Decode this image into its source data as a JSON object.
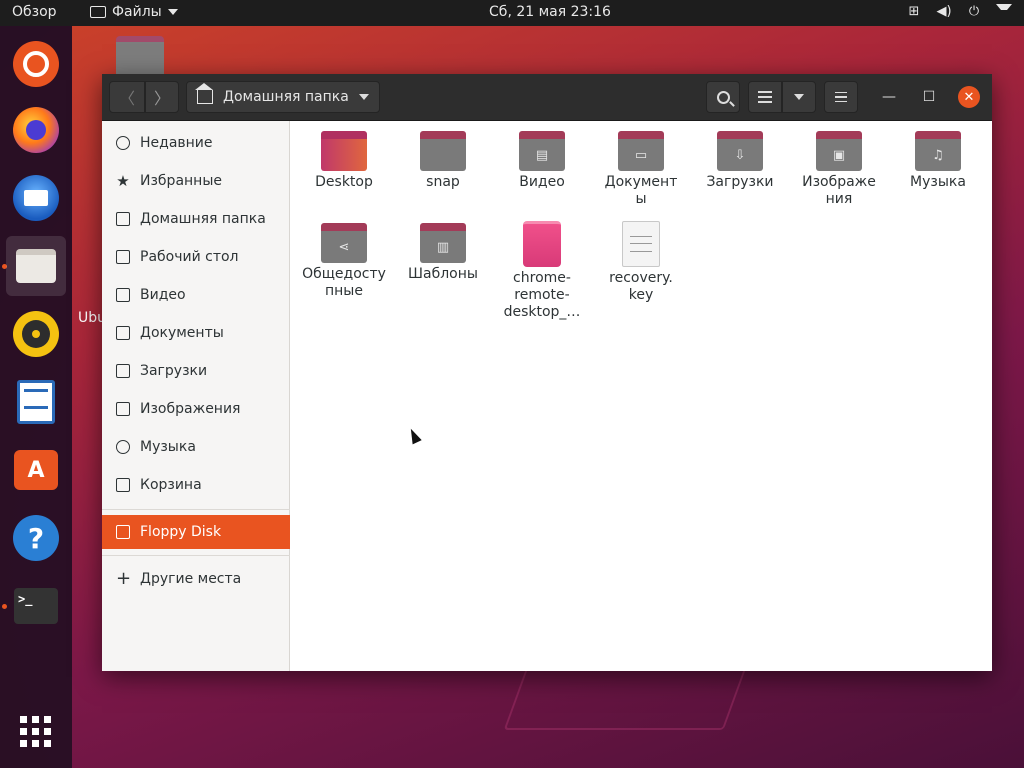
{
  "topbar": {
    "activities": "Обзор",
    "app_menu": "Файлы",
    "clock": "Сб, 21 мая  23:16"
  },
  "dock": {
    "items": [
      {
        "name": "ubuntu"
      },
      {
        "name": "firefox"
      },
      {
        "name": "thunderbird"
      },
      {
        "name": "files",
        "active": true
      },
      {
        "name": "rhythmbox"
      },
      {
        "name": "libreoffice-writer"
      },
      {
        "name": "ubuntu-software"
      },
      {
        "name": "help"
      },
      {
        "name": "terminal"
      }
    ],
    "terminal_glyph": ">_"
  },
  "desktop": {
    "partial_label": "Ubu"
  },
  "window": {
    "path": "Домашняя папка",
    "sidebar": [
      {
        "label": "Недавние",
        "icon": "clock-icon"
      },
      {
        "label": "Избранные",
        "icon": "star-icon"
      },
      {
        "label": "Домашняя папка",
        "icon": "home-icon"
      },
      {
        "label": "Рабочий стол",
        "icon": "desktop-icon"
      },
      {
        "label": "Видео",
        "icon": "video-icon"
      },
      {
        "label": "Документы",
        "icon": "document-icon"
      },
      {
        "label": "Загрузки",
        "icon": "download-icon"
      },
      {
        "label": "Изображения",
        "icon": "image-icon"
      },
      {
        "label": "Музыка",
        "icon": "music-icon"
      },
      {
        "label": "Корзина",
        "icon": "trash-icon"
      },
      {
        "label": "Floppy Disk",
        "icon": "floppy-icon",
        "selected": true
      },
      {
        "label": "Другие места",
        "icon": "plus-icon"
      }
    ],
    "files": [
      {
        "lines": [
          "Desktop"
        ],
        "kind": "folder-desktop"
      },
      {
        "lines": [
          "snap"
        ],
        "kind": "folder"
      },
      {
        "lines": [
          "Видео"
        ],
        "kind": "folder-video"
      },
      {
        "lines": [
          "Документ",
          "ы"
        ],
        "kind": "folder-documents"
      },
      {
        "lines": [
          "Загрузки"
        ],
        "kind": "folder-downloads"
      },
      {
        "lines": [
          "Изображе",
          "ния"
        ],
        "kind": "folder-pictures"
      },
      {
        "lines": [
          "Музыка"
        ],
        "kind": "folder-music"
      },
      {
        "lines": [
          "Общедосту",
          "пные"
        ],
        "kind": "folder-public"
      },
      {
        "lines": [
          "Шаблоны"
        ],
        "kind": "folder-templates"
      },
      {
        "lines": [
          "chrome-",
          "remote-",
          "desktop_…"
        ],
        "kind": "deb-package"
      },
      {
        "lines": [
          "recovery.",
          "key"
        ],
        "kind": "text-file"
      }
    ]
  },
  "colors": {
    "accent": "#e95420",
    "folder_body": "#7a7a7a",
    "folder_tab": "#a33b58"
  }
}
